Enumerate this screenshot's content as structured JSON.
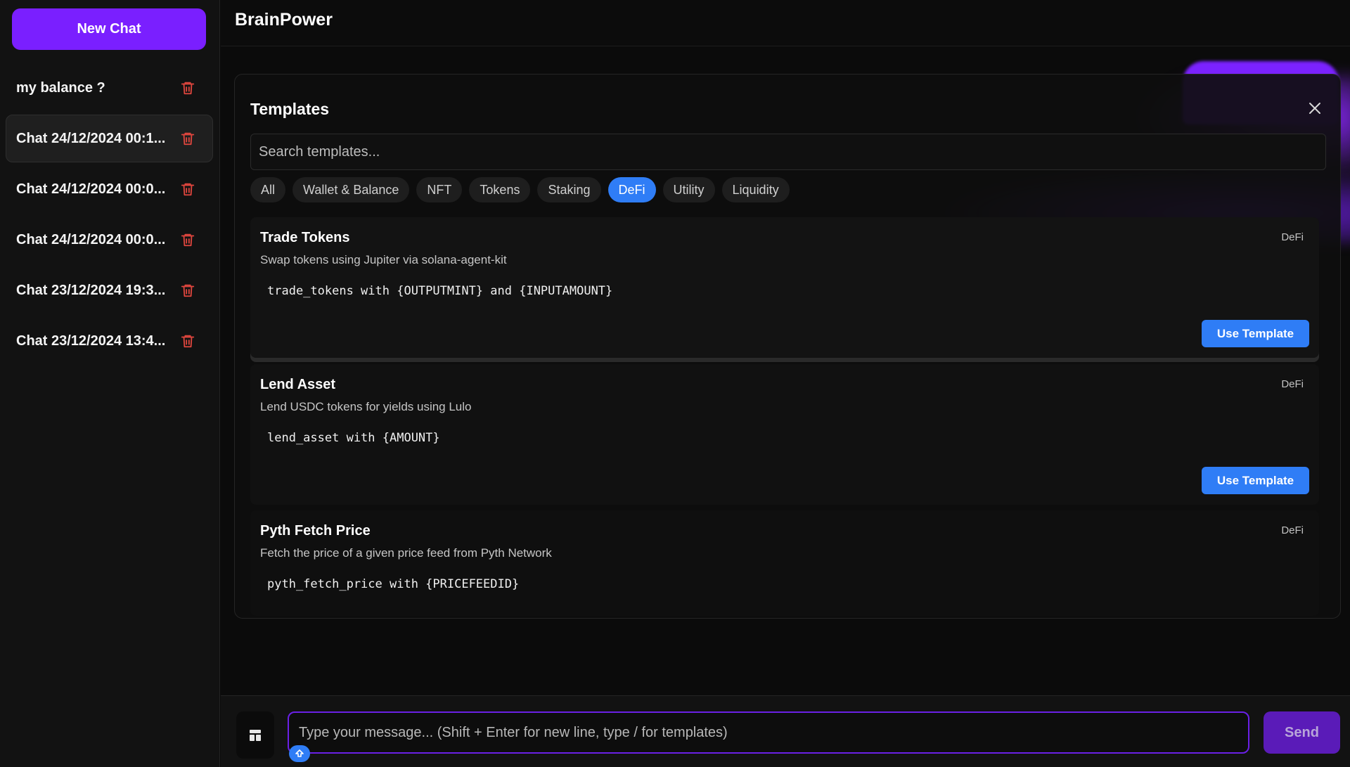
{
  "app": {
    "title": "BrainPower"
  },
  "sidebar": {
    "new_chat_label": "New Chat",
    "chats": [
      {
        "label": "my balance ?",
        "active": false
      },
      {
        "label": "Chat 24/12/2024 00:1...",
        "active": true
      },
      {
        "label": "Chat 24/12/2024 00:0...",
        "active": false
      },
      {
        "label": "Chat 24/12/2024 00:0...",
        "active": false
      },
      {
        "label": "Chat 23/12/2024 19:3...",
        "active": false
      },
      {
        "label": "Chat 23/12/2024 13:4...",
        "active": false
      }
    ]
  },
  "templates": {
    "title": "Templates",
    "search_placeholder": "Search templates...",
    "filters": [
      "All",
      "Wallet & Balance",
      "NFT",
      "Tokens",
      "Staking",
      "DeFi",
      "Utility",
      "Liquidity"
    ],
    "active_filter": "DeFi",
    "use_label": "Use Template",
    "items": [
      {
        "title": "Trade Tokens",
        "category": "DeFi",
        "description": "Swap tokens using Jupiter via solana-agent-kit",
        "code": "trade_tokens with {OUTPUTMINT} and {INPUTAMOUNT}"
      },
      {
        "title": "Lend Asset",
        "category": "DeFi",
        "description": "Lend USDC tokens for yields using Lulo",
        "code": "lend_asset with {AMOUNT}"
      },
      {
        "title": "Pyth Fetch Price",
        "category": "DeFi",
        "description": "Fetch the price of a given price feed from Pyth Network",
        "code": "pyth_fetch_price with {PRICEFEEDID}"
      }
    ]
  },
  "composer": {
    "placeholder": "Type your message... (Shift + Enter for new line, type / for templates)",
    "send_label": "Send"
  },
  "colors": {
    "accent_purple": "#7a1fff",
    "accent_blue": "#2f7df6",
    "danger_red": "#e0463e"
  }
}
